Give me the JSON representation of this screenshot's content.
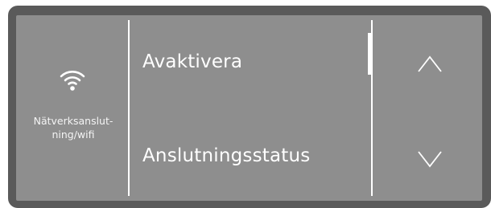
{
  "settings": {
    "icon": "wifi-icon",
    "label": "Nätverksanslut-\nning/wifi"
  },
  "menu": {
    "items": [
      {
        "label": "Avaktivera"
      },
      {
        "label": "Anslutningsstatus"
      }
    ]
  },
  "navigation": {
    "up_icon": "chevron-up-icon",
    "down_icon": "chevron-down-icon"
  },
  "colors": {
    "bezel": "#5a5a5a",
    "screen": "#8e8e8e",
    "foreground": "#ffffff"
  }
}
